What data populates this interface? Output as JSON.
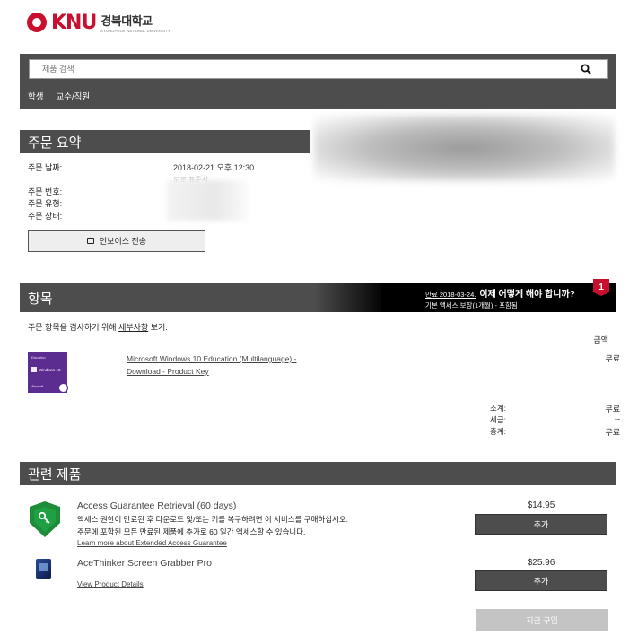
{
  "header": {
    "logo_brand": "KNU",
    "logo_korean": "경북대학교",
    "logo_english": "KYUNGPOOK NATIONAL UNIVERSITY"
  },
  "search": {
    "placeholder": "제품 검색"
  },
  "nav": {
    "items": [
      {
        "label": "학생"
      },
      {
        "label": "교수/직원"
      }
    ]
  },
  "order_summary": {
    "title": "주문 요약",
    "date_label": "주문 날짜:",
    "date_value": "2018-02-21 오후 12:30",
    "date_sub": "도쿄 표준시",
    "number_label": "주문 번호:",
    "type_label": "주문 유형:",
    "status_label": "주문 상태:",
    "invoice_button": "인보이스 전송"
  },
  "items": {
    "title": "항목",
    "promo_date": "만료 2018-03-24.",
    "promo_question": "이제 어떻게 해야 합니까?",
    "promo_sub": "기본 액세스 보장(1개월) - 포함됨",
    "badge_count": "1",
    "info_prefix": "주문 항목을 검사하기 위해 ",
    "info_link": "세부사항",
    "info_suffix": " 보기.",
    "amount_header": "금액",
    "product": {
      "name": "Microsoft Windows 10 Education (Multilanguage) - Download - Product Key",
      "amount": "무료",
      "box_edition": "Education",
      "box_title": "Windows 10",
      "box_brand": "Microsoft"
    },
    "totals": [
      {
        "label": "소계:",
        "value": "무료"
      },
      {
        "label": "세금:",
        "value": "--"
      },
      {
        "label": "총계:",
        "value": "무료"
      }
    ]
  },
  "related": {
    "title": "관련 제품",
    "products": [
      {
        "name": "Access Guarantee Retrieval (60 days)",
        "desc1": "액세스 권한이 만료된 후 다운로드 및/또는 키를 복구하려면 이 서비스를 구매하십시오.",
        "desc2": "주문에 포함된 모든 만료된 제품에 추가로 60 일간 액세스할 수 있습니다.",
        "link": "Learn more about Extended Access Guarantee",
        "price": "$14.95",
        "button": "추가"
      },
      {
        "name": "AceThinker Screen Grabber Pro",
        "link": "View Product Details",
        "price": "$25.96",
        "button": "추가"
      }
    ],
    "buy_button": "지금 구입"
  }
}
